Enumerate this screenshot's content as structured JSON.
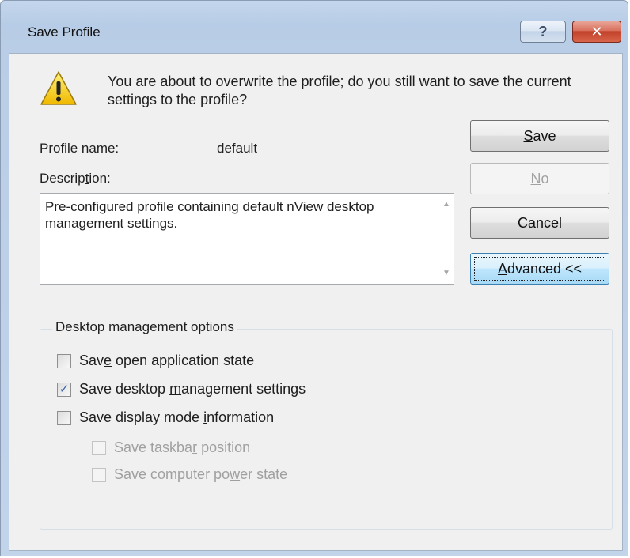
{
  "window": {
    "title": "Save Profile",
    "help_label": "?",
    "close_label": "✕"
  },
  "message": "You are about to overwrite the profile; do you still want to save the current settings to the profile?",
  "profile": {
    "name_label": "Profile name:",
    "name_value": "default",
    "description_label_pre": "Descrip",
    "description_label_key": "t",
    "description_label_post": "ion:",
    "description_value": "Pre-configured profile containing default nView desktop management settings."
  },
  "buttons": {
    "save": {
      "pre": "",
      "key": "S",
      "post": "ave"
    },
    "no": {
      "pre": "",
      "key": "N",
      "post": "o",
      "enabled": false
    },
    "cancel": {
      "label": "Cancel"
    },
    "advanced": {
      "pre": "",
      "key": "A",
      "post": "dvanced <<"
    }
  },
  "options": {
    "group_label": "Desktop management options",
    "items": [
      {
        "pre": "Sav",
        "key": "e",
        "post": " open application state",
        "checked": false,
        "enabled": true
      },
      {
        "pre": "Save desktop ",
        "key": "m",
        "post": "anagement settings",
        "checked": true,
        "enabled": true
      },
      {
        "pre": "Save display mode ",
        "key": "i",
        "post": "nformation",
        "checked": false,
        "enabled": true
      },
      {
        "pre": "Save taskba",
        "key": "r",
        "post": " position",
        "checked": false,
        "enabled": false
      },
      {
        "pre": "Save computer po",
        "key": "w",
        "post": "er state",
        "checked": false,
        "enabled": false
      }
    ]
  },
  "icons": {
    "warning": "warning-icon",
    "scroll_up": "scroll-up-arrow-icon",
    "scroll_down": "scroll-down-arrow-icon",
    "check": "✓"
  },
  "colors": {
    "titlebar": "#b9cde6",
    "close_button": "#c2412a",
    "dialog_face": "#f0f0f0",
    "focus_button": "#bee6fd"
  }
}
